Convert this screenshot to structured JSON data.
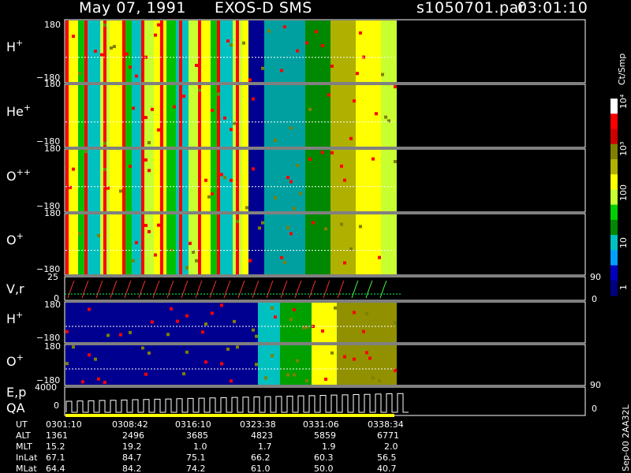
{
  "header": {
    "date": "May 07, 1991",
    "instrument": "EXOS-D SMS",
    "file": "s1050701.par",
    "time": "03:01:10"
  },
  "colorbar": {
    "label": "Ct/Smp",
    "ticks": [
      "10⁴",
      "10³",
      "100",
      "10",
      "1"
    ],
    "colors": [
      "#ffffff",
      "#ff0000",
      "#cc0000",
      "#808000",
      "#b0b000",
      "#ffff00",
      "#c8ff30",
      "#00d000",
      "#008800",
      "#00c0c0",
      "#00a0ff",
      "#0000c0",
      "#000080"
    ]
  },
  "panels": [
    {
      "label": "H",
      "sup": "+",
      "ymax": "180",
      "ymin": "−180"
    },
    {
      "label": "He",
      "sup": "+",
      "ymax": "180",
      "ymin": "−180"
    },
    {
      "label": "O",
      "sup": "++",
      "ymax": "180",
      "ymin": "−180"
    },
    {
      "label": "O",
      "sup": "+",
      "ymax": "180",
      "ymin": "−180"
    },
    {
      "label": "V,r",
      "sup": "",
      "ymax": "25",
      "ymin": "0",
      "right_top": "90",
      "right_bot": "0"
    },
    {
      "label": "H",
      "sup": "+",
      "ymax": "180",
      "ymin": "−180"
    },
    {
      "label": "O",
      "sup": "+",
      "ymax": "180",
      "ymin": "−180"
    },
    {
      "label": "E,p",
      "label2": "QA",
      "sup": "",
      "ymax": "4000",
      "ymin": "0",
      "right_top": "90",
      "right_bot": "0"
    }
  ],
  "footer": {
    "rows": [
      {
        "name": "UT",
        "values": [
          "0301:10",
          "0308:42",
          "0316:10",
          "0323:38",
          "0331:06",
          "0338:34"
        ]
      },
      {
        "name": "ALT",
        "values": [
          "1361",
          "2496",
          "3685",
          "4823",
          "5859",
          "6771"
        ]
      },
      {
        "name": "MLT",
        "values": [
          "15.2",
          "19.2",
          "1.0",
          "1.7",
          "1.9",
          "2.0"
        ]
      },
      {
        "name": "InLat",
        "values": [
          "67.1",
          "84.7",
          "75.1",
          "66.2",
          "60.3",
          "56.5"
        ]
      },
      {
        "name": "MLat",
        "values": [
          "64.4",
          "84.2",
          "74.2",
          "61.0",
          "50.0",
          "40.7"
        ]
      }
    ],
    "stamp": "Sep-00 2AA32L"
  },
  "chart_data": {
    "type": "heatmap",
    "title": "May 07, 1991   EXOS-D SMS",
    "xlabel": "UT",
    "x_ticks": [
      "0301:10",
      "0308:42",
      "0316:10",
      "0323:38",
      "0331:06",
      "0338:34"
    ],
    "colorbar_label": "Ct/Smp",
    "colorbar_range": [
      1,
      10000
    ],
    "colorbar_scale": "log",
    "panels": [
      {
        "name": "H+",
        "ylim": [
          -180,
          180
        ]
      },
      {
        "name": "He+",
        "ylim": [
          -180,
          180
        ]
      },
      {
        "name": "O++",
        "ylim": [
          -180,
          180
        ]
      },
      {
        "name": "O+",
        "ylim": [
          -180,
          180
        ]
      },
      {
        "name": "V,r",
        "ylim": [
          0,
          25
        ],
        "right_ylim": [
          0,
          90
        ]
      },
      {
        "name": "H+",
        "ylim": [
          -180,
          180
        ]
      },
      {
        "name": "O+",
        "ylim": [
          -180,
          180
        ]
      },
      {
        "name": "E,p",
        "ylim": [
          0,
          4000
        ],
        "right_ylim": [
          0,
          90
        ]
      }
    ]
  }
}
